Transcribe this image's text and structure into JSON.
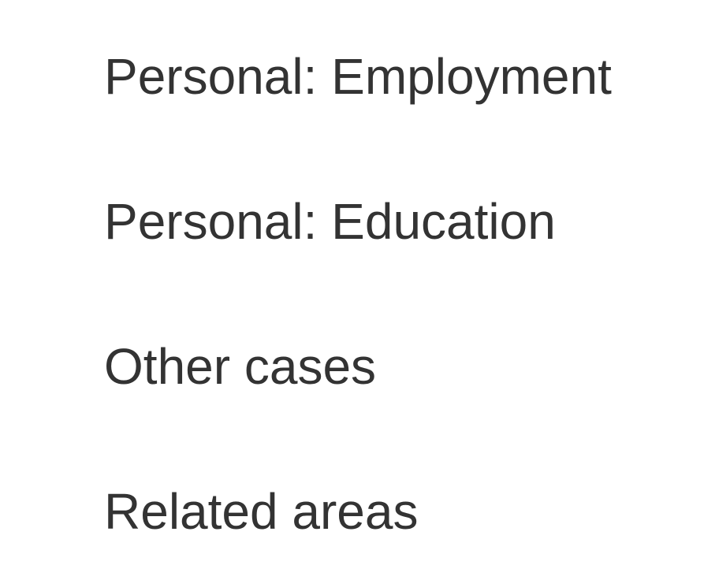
{
  "nav": {
    "items": [
      {
        "label": "Personal: Employment"
      },
      {
        "label": "Personal: Education"
      },
      {
        "label": "Other cases"
      },
      {
        "label": "Related areas"
      }
    ]
  },
  "colors": {
    "text": "#333333",
    "background": "#ffffff"
  }
}
